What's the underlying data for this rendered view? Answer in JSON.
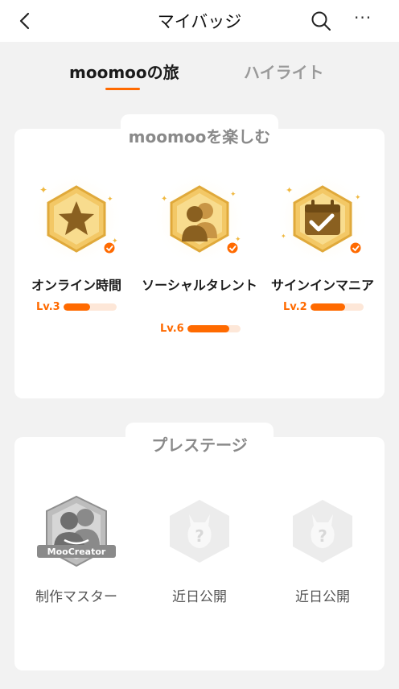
{
  "header": {
    "title": "マイバッジ",
    "more_label": "···"
  },
  "tabs": [
    {
      "label": "moomooの旅",
      "active": true
    },
    {
      "label": "ハイライト",
      "active": false
    }
  ],
  "sections": [
    {
      "title": "moomooを楽しむ",
      "badges": [
        {
          "name": "オンライン時間",
          "level": "Lv.3",
          "progress": 0.5,
          "icon": "star-icon"
        },
        {
          "name": "ソーシャルタレント",
          "level": "Lv.6",
          "progress": 0.8,
          "icon": "people-icon"
        },
        {
          "name": "サインインマニア",
          "level": "Lv.2",
          "progress": 0.65,
          "icon": "calendar-check-icon"
        }
      ]
    },
    {
      "title": "プレステージ",
      "badges": [
        {
          "name": "制作マスター",
          "emblem": "MooCreator",
          "icon": "moocreator-badge-icon"
        },
        {
          "name": "近日公開",
          "icon": "question-badge-icon"
        },
        {
          "name": "近日公開",
          "icon": "question-badge-icon"
        }
      ]
    }
  ],
  "colors": {
    "accent": "#ff6a00",
    "badge_gold": "#f0c060",
    "badge_brown": "#8a6020",
    "locked_gray": "#e8e8e8"
  }
}
